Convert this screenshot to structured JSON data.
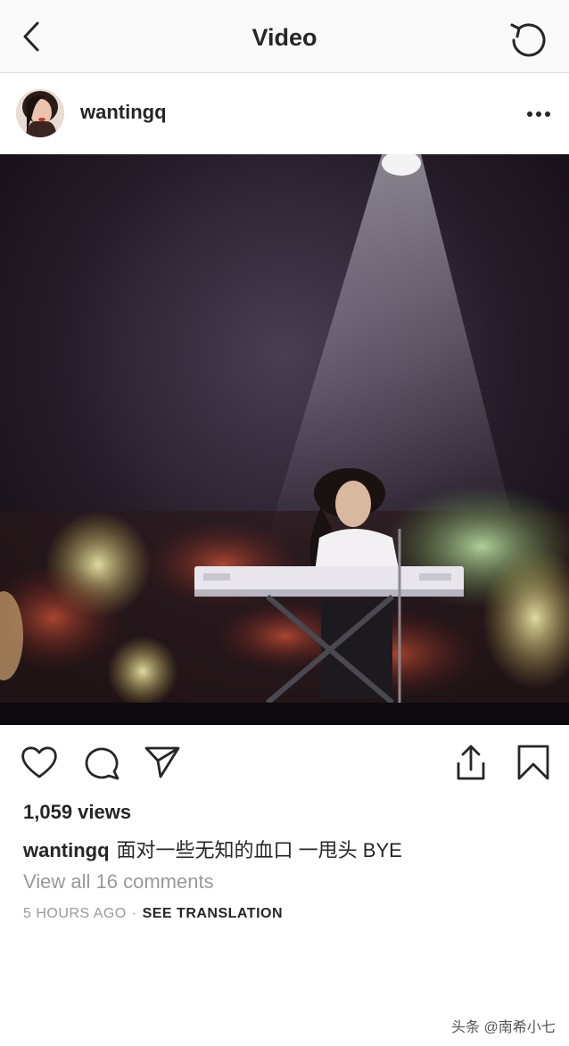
{
  "navbar": {
    "title": "Video",
    "back_icon": "chevron-left-icon",
    "refresh_icon": "refresh-icon"
  },
  "post": {
    "username": "wantingq",
    "more_icon": "more-horizontal-icon"
  },
  "actions": {
    "like_icon": "heart-icon",
    "comment_icon": "comment-icon",
    "share_icon": "send-icon",
    "upload_icon": "upload-icon",
    "save_icon": "bookmark-icon"
  },
  "stats": {
    "views": "1,059 views"
  },
  "caption": {
    "username": "wantingq",
    "text": "面对一些无知的血口 一甩头 BYE"
  },
  "comments_link": "View all 16 comments",
  "meta": {
    "time": "5 HOURS AGO",
    "separator": "·",
    "translate": "SEE TRANSLATION"
  },
  "watermark": "头条 @南希小七",
  "colors": {
    "text": "#262626",
    "secondary": "#999999",
    "navbar_bg": "#f9f9f9",
    "divider": "#dbdbdb"
  }
}
